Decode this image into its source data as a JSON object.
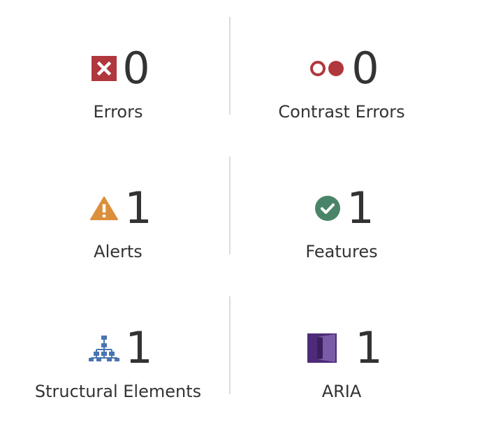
{
  "summary": {
    "errors": {
      "label": "Errors",
      "count": "0",
      "icon": "error-icon",
      "color": "#b0373c"
    },
    "contrast_errors": {
      "label": "Contrast Errors",
      "count": "0",
      "icon": "contrast-icon",
      "color": "#b0373c"
    },
    "alerts": {
      "label": "Alerts",
      "count": "1",
      "icon": "alert-icon",
      "color": "#dc8f3a"
    },
    "features": {
      "label": "Features",
      "count": "1",
      "icon": "feature-icon",
      "color": "#4a8468"
    },
    "structural_elements": {
      "label": "Structural Elements",
      "count": "1",
      "icon": "structure-icon",
      "color": "#4a74b0"
    },
    "aria": {
      "label": "ARIA",
      "count": "1",
      "icon": "aria-icon",
      "color": "#4d2a7a"
    }
  }
}
